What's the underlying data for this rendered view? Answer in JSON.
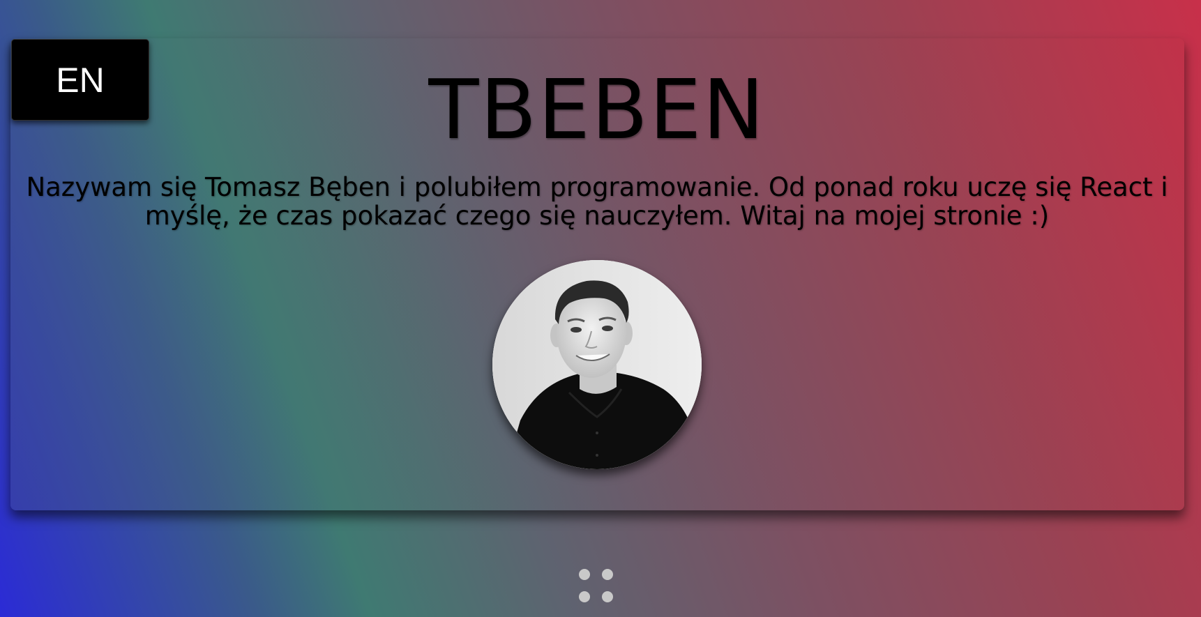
{
  "language_toggle": {
    "label": "EN"
  },
  "header": {
    "title": "TBEBEN"
  },
  "intro": {
    "text": "Nazywam się Tomasz Bęben i polubiłem programowanie. Od ponad roku uczę się React i myślę, że czas pokazać czego się nauczyłem. Witaj na mojej stronie :)"
  },
  "avatar": {
    "icon": "profile-photo"
  },
  "menu": {
    "icon": "grid-dots-icon"
  },
  "colors": {
    "button_bg": "#000000",
    "text": "#000000",
    "gradient_left": "#2b2bd6",
    "gradient_right": "#c8304a",
    "dot": "#c9c9c9"
  }
}
